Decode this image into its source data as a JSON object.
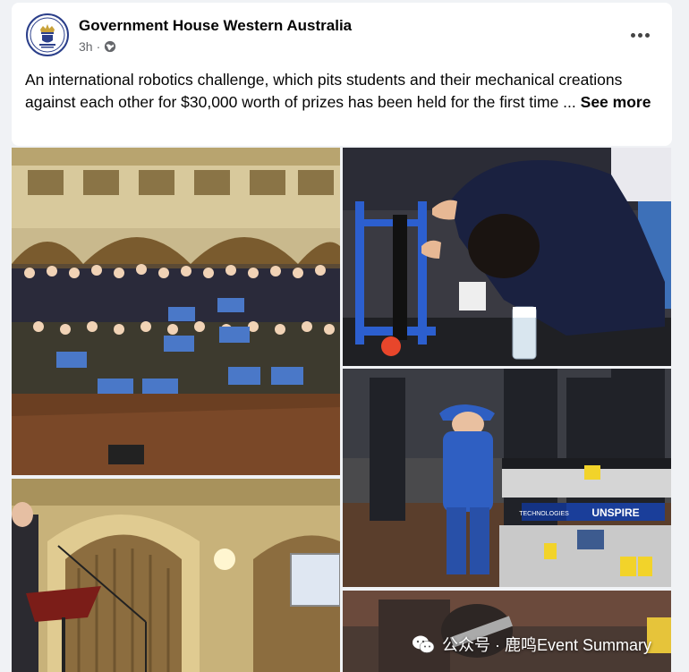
{
  "post": {
    "page_name": "Government House Western Australia",
    "time": "3h",
    "dot": "·",
    "body_text": "An international robotics challenge, which pits students and their mechanical creations against each other for $30,000 worth of prizes has been held for the first time ...",
    "see_more": "See more"
  },
  "photos": {
    "sign_brand": "UNSPIRE",
    "sign_sub": "TECHNOLOGIES"
  },
  "watermark": {
    "text": "公众号 · 鹿鸣Event Summary"
  },
  "icons": [
    "crest-icon",
    "globe-icon",
    "more-icon",
    "wechat-icon"
  ],
  "colors": {
    "text": "#050505",
    "secondary": "#65676b",
    "background": "#f0f2f5",
    "card": "#ffffff"
  }
}
